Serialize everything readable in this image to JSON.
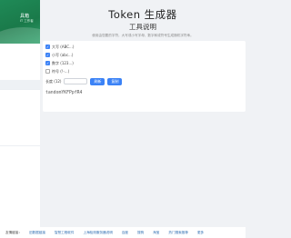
{
  "sidebar": {
    "brand_title": "具箱",
    "brand_subtitle": "IT 工作者",
    "items": [
      "",
      "",
      "",
      "",
      "",
      "",
      ""
    ]
  },
  "main": {
    "title": "Token 生成器",
    "subtitle": "工具说明",
    "description": "使用由您要的字符，大写或小写字母、数字和或符号生成随机字符串。"
  },
  "generator": {
    "options": [
      {
        "label": "大写 (ABC...)",
        "checked": true
      },
      {
        "label": "小写 (abc...)",
        "checked": true
      },
      {
        "label": "数字 (123...)",
        "checked": true
      },
      {
        "label": "符号 (!-...)",
        "checked": false
      }
    ],
    "length_label": "长度 (12)",
    "length_value": "",
    "refresh_label": "刷新",
    "copy_label": "复制",
    "token": "tandomYKFPpfR4"
  },
  "footer": {
    "label": "友情链接：",
    "links": [
      "旧数据链接",
      "智慧工程软件",
      "上海检测服务器说明",
      "百度",
      "搜狗",
      "淘宝",
      "热门搜索推荐",
      "更多"
    ]
  },
  "colors": {
    "brand_green": "#1f8a57",
    "accent_blue": "#3b82f6"
  }
}
